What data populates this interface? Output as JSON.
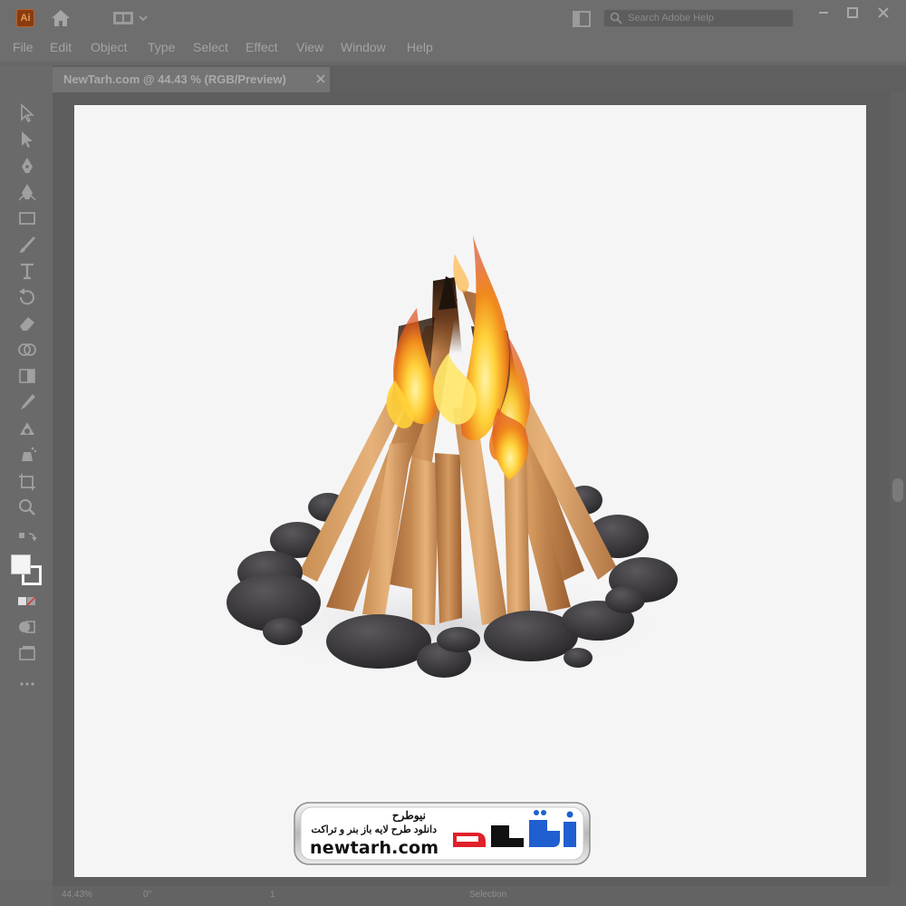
{
  "titlebar": {
    "app_icon_text": "Ai",
    "search_placeholder": "Search Adobe Help",
    "icons": [
      "illustrator-app-icon",
      "home-icon",
      "workspace-switcher-icon",
      "arrange-documents-icon",
      "search-icon",
      "minimize-icon",
      "maximize-icon",
      "close-icon"
    ]
  },
  "menubar": {
    "items": [
      "File",
      "Edit",
      "Object",
      "Type",
      "Select",
      "Effect",
      "View",
      "Window",
      "Help"
    ]
  },
  "document": {
    "tab_label": "NewTarh.com @ 44.43 % (RGB/Preview)"
  },
  "tools": [
    "selection-tool",
    "direct-selection-tool",
    "pen-tool",
    "curvature-tool",
    "rectangle-tool",
    "paintbrush-tool",
    "type-tool",
    "rotate-tool",
    "eraser-tool",
    "shape-builder-tool",
    "gradient-tool",
    "eyedropper-tool",
    "blend-tool",
    "symbol-sprayer-tool",
    "artboard-tool",
    "zoom-tool"
  ],
  "statusbar": {
    "zoom": "44.43%",
    "rotation": "0°",
    "artboard_index": "1",
    "mode": "Selection"
  },
  "watermark": {
    "brand_fa": "نیوطرح",
    "tagline_fa": "دانلود طرح لایه باز بنر و تراکت",
    "url": "newtarh.com",
    "brand_color": "#e0202a"
  },
  "colors": {
    "ui_chrome": "#6e6e6e",
    "artboard": "#f5f5f6",
    "fire_orange": "#f08a1c",
    "wood": "#c98a52",
    "stone": "#3a383b"
  }
}
